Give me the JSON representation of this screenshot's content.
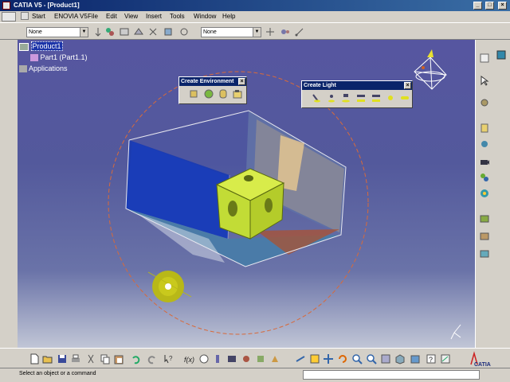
{
  "window": {
    "title": "CATIA V5 - [Product1]"
  },
  "menu": {
    "items": [
      "Start",
      "ENOVIA V5",
      "File",
      "Edit",
      "View",
      "Insert",
      "Tools",
      "Window",
      "Help"
    ]
  },
  "toolbar_top": {
    "combo1_value": "None",
    "combo2_value": "None"
  },
  "tree": {
    "root": "Product1",
    "child": "Part1 (Part1.1)",
    "applications": "Applications"
  },
  "create_environment": {
    "title": "Create Environment"
  },
  "create_light": {
    "title": "Create Light"
  },
  "status": {
    "message": "Select an object or a command",
    "command_input": ""
  },
  "colors": {
    "viewport_top": "#5656a0",
    "cube": "#c8e03a",
    "title_bar": "#0a246a",
    "light_orb": "#d0d020",
    "orbit_ring": "#d86a3a"
  },
  "brand": "CATIA"
}
